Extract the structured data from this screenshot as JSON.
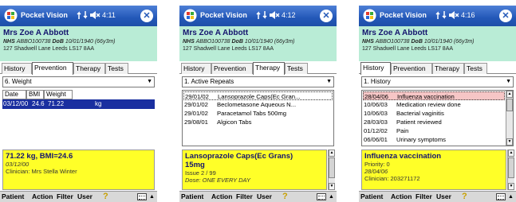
{
  "app": {
    "name": "Pocket Vision"
  },
  "patient": {
    "name": "Mrs Zoe A Abbott",
    "nhs_label": "NHS",
    "nhs_number": "ABBO100738",
    "dob_label": "DoB",
    "dob": "10/01/1940 (66y3m)",
    "address": "127 Shadwell Lane Leeds LS17 8AA"
  },
  "tabs": [
    "History",
    "Prevention",
    "Therapy",
    "Tests"
  ],
  "menu": [
    "Patient",
    "Action",
    "Filter",
    "User"
  ],
  "icons": {
    "logo": "windows-flag-icon",
    "connection": "connectivity-icon",
    "speaker": "speaker-muted-icon",
    "close": "close-icon",
    "help": "help-icon",
    "keyboard": "keyboard-icon"
  },
  "colors": {
    "titlebar": "#2358b8",
    "patient_bg": "#b9ecd6",
    "detail_bg": "#ffff28",
    "selection": "#1a2fa0",
    "highlight": "#f6c6c6"
  },
  "screens": [
    {
      "time": "4:11",
      "active_tab": "Prevention",
      "filter": "6. Weight",
      "table": {
        "headers": [
          "Date",
          "BMI",
          "Weight"
        ],
        "row": {
          "date": "03/12/00",
          "bmi": "24.6",
          "weight": "71.22",
          "unit": "kg"
        }
      },
      "detail": {
        "line1": "71.22 kg, BMI=24.6",
        "line2": "03/12/00",
        "line3": "Clinician: Mrs Stella Winter"
      }
    },
    {
      "time": "4:12",
      "active_tab": "Therapy",
      "filter": "1. Active Repeats",
      "list": [
        {
          "date": "29/01/02",
          "text": "Lansoprazole Caps(Ec Gran..."
        },
        {
          "date": "29/01/02",
          "text": "Beclometasone Aqueous N..."
        },
        {
          "date": "29/01/02",
          "text": "Paracetamol Tabs 500mg"
        },
        {
          "date": "29/08/01",
          "text": "Algicon Tabs"
        }
      ],
      "detail": {
        "line1": "Lansoprazole Caps(Ec Grans)",
        "line1b": "15mg",
        "line2": "Issue 2 / 99",
        "line3": "Dose: ONE EVERY DAY"
      }
    },
    {
      "time": "4:16",
      "active_tab": "History",
      "filter": "1. History",
      "list": [
        {
          "date": "28/04/06",
          "text": "Influenza vaccination"
        },
        {
          "date": "10/06/03",
          "text": "Medication review done"
        },
        {
          "date": "10/06/03",
          "text": "Bacterial vaginitis"
        },
        {
          "date": "28/03/03",
          "text": "Patient reviewed"
        },
        {
          "date": "01/12/02",
          "text": "Pain"
        },
        {
          "date": "06/06/01",
          "text": "Urinary symptoms"
        }
      ],
      "detail": {
        "line1": "Influenza vaccination",
        "line2": "Priority: 0",
        "line3": "28/04/06",
        "line4": "Clinician: 203271172"
      }
    }
  ]
}
